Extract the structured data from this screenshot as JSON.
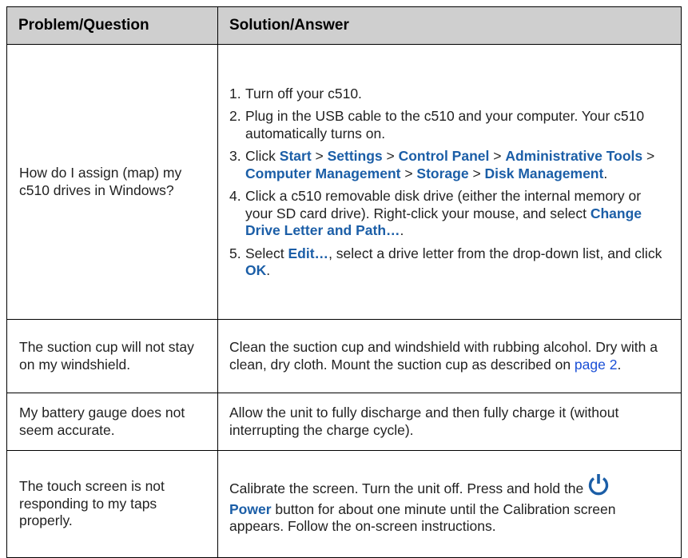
{
  "header": {
    "col1": "Problem/Question",
    "col2": "Solution/Answer"
  },
  "row1": {
    "question": "How do I assign (map) my c510 drives in Windows?",
    "steps": [
      {
        "num": "1.",
        "parts": [
          "Turn off your c510."
        ]
      },
      {
        "num": "2.",
        "parts": [
          "Plug in the USB cable to the c510 and your computer. Your c510 automatically turns on."
        ]
      },
      {
        "num": "3.",
        "parts": [
          "Click ",
          "Start",
          " > ",
          "Settings",
          " > ",
          "Control Panel",
          " > ",
          "Administrative Tools",
          " > ",
          "Computer Management",
          " > ",
          "Storage",
          " > ",
          "Disk Management",
          "."
        ]
      },
      {
        "num": "4.",
        "parts": [
          "Click a c510 removable disk drive (either the internal memory or your SD card drive). Right-click your mouse, and select ",
          "Change Drive Letter and Path…",
          "."
        ]
      },
      {
        "num": "5.",
        "parts": [
          "Select ",
          "Edit…",
          ", select a drive letter from the drop-down list, and click ",
          "OK",
          "."
        ]
      }
    ]
  },
  "row2": {
    "question": "The suction cup will not stay on my windshield.",
    "answer": "Clean the suction cup and windshield with rubbing alcohol. Dry with a clean, dry cloth. Mount the suction cup as described on ",
    "link": "page 2",
    "after": "."
  },
  "row3": {
    "question": "My battery gauge does not seem accurate.",
    "answer": "Allow the unit to fully discharge and then fully charge it (without interrupting the charge cycle)."
  },
  "row4": {
    "question": "The touch screen is not responding to my taps properly.",
    "answer_a": "Calibrate the screen. Turn the unit off. Press and hold the",
    "power_label": "Power",
    "answer_b": " button for about one minute until the Calibration screen appears. Follow the on-screen instructions.",
    "icon": "power-icon",
    "icon_color": "#1b5ea7"
  }
}
